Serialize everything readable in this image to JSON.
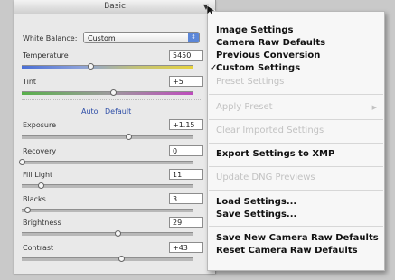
{
  "panel": {
    "title": "Basic",
    "white_balance": {
      "label": "White Balance:",
      "value": "Custom"
    },
    "sliders": [
      {
        "id": "temperature",
        "label": "Temperature",
        "value": "5450",
        "level": 0.4
      },
      {
        "id": "tint",
        "label": "Tint",
        "value": "+5",
        "level": 0.53
      },
      {
        "id": "exposure",
        "label": "Exposure",
        "value": "+1.15",
        "level": 0.62
      },
      {
        "id": "recovery",
        "label": "Recovery",
        "value": "0",
        "level": 0.0
      },
      {
        "id": "fill-light",
        "label": "Fill Light",
        "value": "11",
        "level": 0.11
      },
      {
        "id": "blacks",
        "label": "Blacks",
        "value": "3",
        "level": 0.03
      },
      {
        "id": "brightness",
        "label": "Brightness",
        "value": "29",
        "level": 0.56
      },
      {
        "id": "contrast",
        "label": "Contrast",
        "value": "+43",
        "level": 0.58
      }
    ],
    "auto_label": "Auto",
    "default_label": "Default"
  },
  "menu": {
    "items": [
      {
        "id": "image-settings",
        "label": "Image Settings",
        "enabled": true
      },
      {
        "id": "camera-raw-defaults",
        "label": "Camera Raw Defaults",
        "enabled": true
      },
      {
        "id": "previous-conversion",
        "label": "Previous Conversion",
        "enabled": true
      },
      {
        "id": "custom-settings",
        "label": "Custom Settings",
        "enabled": true,
        "checked": true
      },
      {
        "id": "preset-settings",
        "label": "Preset Settings",
        "enabled": false
      },
      {
        "id": "apply-preset",
        "label": "Apply Preset",
        "enabled": false,
        "submenu": true
      },
      {
        "id": "clear-imported-settings",
        "label": "Clear Imported Settings",
        "enabled": false
      },
      {
        "id": "export-settings-xmp",
        "label": "Export Settings to XMP",
        "enabled": true
      },
      {
        "id": "update-dng-previews",
        "label": "Update DNG Previews",
        "enabled": false
      },
      {
        "id": "load-settings",
        "label": "Load Settings...",
        "enabled": true
      },
      {
        "id": "save-settings",
        "label": "Save Settings...",
        "enabled": true
      },
      {
        "id": "save-new-camera-raw-defaults",
        "label": "Save New Camera Raw Defaults",
        "enabled": true
      },
      {
        "id": "reset-camera-raw-defaults",
        "label": "Reset Camera Raw Defaults",
        "enabled": true
      }
    ]
  },
  "colors": {
    "accent": "#5b86d8",
    "link": "#2e4ea7"
  }
}
